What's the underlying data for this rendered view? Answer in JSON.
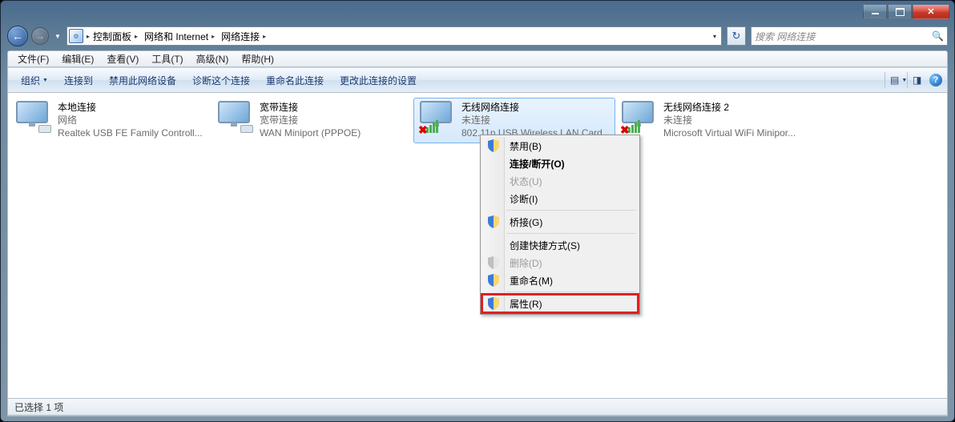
{
  "breadcrumb": {
    "p1": "控制面板",
    "p2": "网络和 Internet",
    "p3": "网络连接"
  },
  "search": {
    "placeholder": "搜索 网络连接"
  },
  "menu": {
    "file": "文件(F)",
    "edit": "编辑(E)",
    "view": "查看(V)",
    "tools": "工具(T)",
    "advanced": "高级(N)",
    "help": "帮助(H)"
  },
  "toolbar": {
    "organize": "组织",
    "connect": "连接到",
    "disable": "禁用此网络设备",
    "diagnose": "诊断这个连接",
    "rename": "重命名此连接",
    "change": "更改此连接的设置"
  },
  "items": [
    {
      "title": "本地连接",
      "sub": "网络",
      "detail": "Realtek USB FE Family Controll...",
      "kind": "lan"
    },
    {
      "title": "宽带连接",
      "sub": "宽带连接",
      "detail": "WAN Miniport (PPPOE)",
      "kind": "wan"
    },
    {
      "title": "无线网络连接",
      "sub": "未连接",
      "detail": "802.11n USB Wireless LAN Card",
      "kind": "wifi",
      "selected": true,
      "x": true
    },
    {
      "title": "无线网络连接 2",
      "sub": "未连接",
      "detail": "Microsoft Virtual WiFi Minipor...",
      "kind": "wifi",
      "x": true
    }
  ],
  "ctx": {
    "disable": "禁用(B)",
    "connect": "连接/断开(O)",
    "status": "状态(U)",
    "diagnose": "诊断(I)",
    "bridge": "桥接(G)",
    "shortcut": "创建快捷方式(S)",
    "delete": "删除(D)",
    "rename": "重命名(M)",
    "properties": "属性(R)"
  },
  "status": "已选择 1 项"
}
